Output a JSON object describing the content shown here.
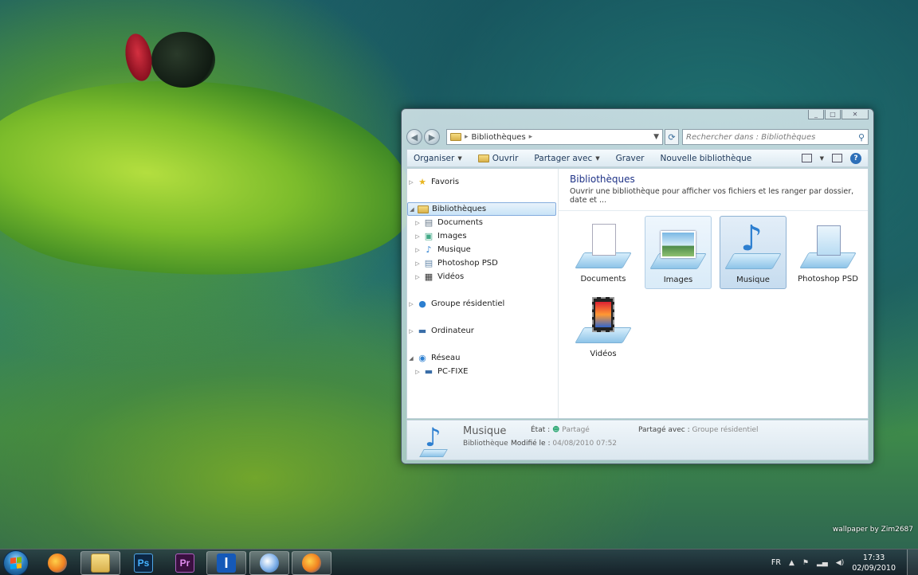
{
  "desktop": {
    "wallpaper_credit": "wallpaper by Zim2687"
  },
  "window": {
    "address": {
      "crumb": "Bibliothèques",
      "arrow": "▸"
    },
    "search": {
      "placeholder": "Rechercher dans : Bibliothèques"
    },
    "toolbar": {
      "organiser": "Organiser",
      "ouvrir": "Ouvrir",
      "partager": "Partager avec",
      "graver": "Graver",
      "nouvelle": "Nouvelle bibliothèque"
    },
    "nav": {
      "favoris": "Favoris",
      "bibliotheques": "Bibliothèques",
      "documents": "Documents",
      "images": "Images",
      "musique": "Musique",
      "photoshop": "Photoshop PSD",
      "videos": "Vidéos",
      "groupe": "Groupe résidentiel",
      "ordinateur": "Ordinateur",
      "reseau": "Réseau",
      "pcfixe": "PC-FIXE"
    },
    "main": {
      "title": "Bibliothèques",
      "subtitle": "Ouvrir une bibliothèque pour afficher vos fichiers et les ranger par dossier, date et ...",
      "tiles": {
        "documents": "Documents",
        "images": "Images",
        "musique": "Musique",
        "photoshop": "Photoshop PSD",
        "videos": "Vidéos"
      }
    },
    "details": {
      "name": "Musique",
      "type": "Bibliothèque",
      "state_label": "État :",
      "state_value": "Partagé",
      "shared_label": "Partagé avec :",
      "shared_value": "Groupe résidentiel",
      "modified_label": "Modifié le :",
      "modified_value": "04/08/2010 07:52"
    }
  },
  "taskbar": {
    "apps": {
      "ps": "Ps",
      "pr": "Pr",
      "i": "I"
    },
    "tray": {
      "lang": "FR",
      "time": "17:33",
      "date": "02/09/2010"
    }
  },
  "colors": {
    "accent_title": "#1e3287",
    "selection": "#c9e3f7",
    "taskbar": "#1c2a33"
  }
}
